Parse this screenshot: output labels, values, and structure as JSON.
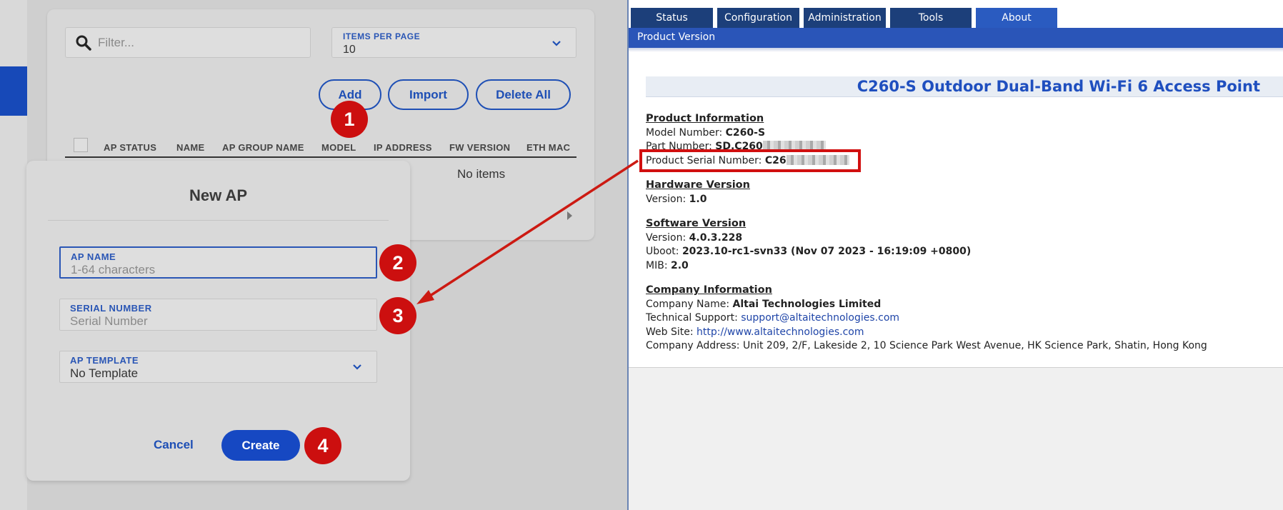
{
  "left": {
    "filter": {
      "placeholder": "Filter..."
    },
    "items_per_page": {
      "label": "ITEMS PER PAGE",
      "value": "10"
    },
    "buttons": {
      "add": "Add",
      "import": "Import",
      "delete_all": "Delete All"
    },
    "table": {
      "columns": [
        "AP STATUS",
        "NAME",
        "AP GROUP NAME",
        "MODEL",
        "IP ADDRESS",
        "FW VERSION",
        "ETH MAC"
      ],
      "empty_text": "No items"
    },
    "modal": {
      "title": "New AP",
      "fields": {
        "ap_name": {
          "label": "AP NAME",
          "placeholder": "1-64 characters"
        },
        "serial": {
          "label": "SERIAL NUMBER",
          "placeholder": "Serial Number"
        },
        "template": {
          "label": "AP TEMPLATE",
          "value": "No Template"
        }
      },
      "cancel": "Cancel",
      "create": "Create"
    },
    "steps": [
      "1",
      "2",
      "3",
      "4"
    ]
  },
  "right": {
    "tabs": [
      "Status",
      "Configuration",
      "Administration",
      "Tools",
      "About"
    ],
    "active_tab": "About",
    "subheader": "Product Version",
    "product_title": "C260-S Outdoor Dual-Band Wi-Fi 6 Access Point",
    "product_info": {
      "heading": "Product Information",
      "model_label": "Model Number:",
      "model_value": "C260-S",
      "part_label": "Part Number:",
      "part_value": "SD.C260",
      "serial_label": "Product Serial Number:",
      "serial_value": "C26"
    },
    "hardware": {
      "heading": "Hardware Version",
      "version_label": "Version:",
      "version_value": "1.0"
    },
    "software": {
      "heading": "Software Version",
      "version_label": "Version:",
      "version_value": "4.0.3.228",
      "uboot_label": "Uboot:",
      "uboot_value": "2023.10-rc1-svn33 (Nov 07 2023 - 16:19:09 +0800)",
      "mib_label": "MIB:",
      "mib_value": "2.0"
    },
    "company": {
      "heading": "Company Information",
      "name_label": "Company Name:",
      "name_value": "Altai Technologies Limited",
      "support_label": "Technical Support:",
      "support_value": "support@altaitechnologies.com",
      "web_label": "Web Site:",
      "web_value": "http://www.altaitechnologies.com",
      "address_label": "Company Address:",
      "address_value": "Unit 209, 2/F, Lakeside 2, 10 Science Park West Avenue, HK Science Park, Shatin, Hong Kong"
    }
  },
  "colors": {
    "accent_blue": "#1e4fb5",
    "nav_dark": "#1c3f7a",
    "nav_active": "#2a5bc0",
    "annotation_red": "#cc0f0f"
  }
}
